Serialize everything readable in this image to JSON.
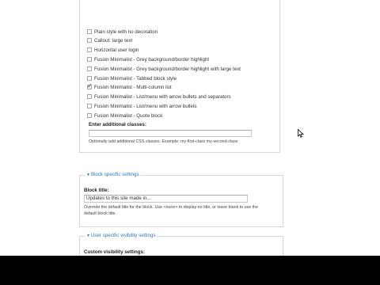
{
  "styles": {
    "options": [
      {
        "label": "Plain style with no decoration",
        "checked": false
      },
      {
        "label": "Callout: large text",
        "checked": false
      },
      {
        "label": "Horizontal user login",
        "checked": false
      },
      {
        "label": "Fusion Minimalist - Grey background/border highlight",
        "checked": false
      },
      {
        "label": "Fusion Minimalist - Grey background/border highlight with large text",
        "checked": false
      },
      {
        "label": "Fusion Minimalist - Tabbed block style",
        "checked": false
      },
      {
        "label": "Fusion Minimalist - Multi-column list",
        "checked": true
      },
      {
        "label": "Fusion Minimalist - List/menu with arrow bullets and separators",
        "checked": false
      },
      {
        "label": "Fusion Minimalist - List/menu with arrow bullets",
        "checked": false
      },
      {
        "label": "Fusion Minimalist - Quote block",
        "checked": false
      }
    ],
    "extra_label": "Enter additional classes:",
    "extra_value": "",
    "extra_help": "Optionally add additional CSS classes. Example: my-first-class my-second-class"
  },
  "block": {
    "legend": "Block specific settings",
    "title_label": "Block title:",
    "title_value": "Updates to this site made in...",
    "help_1": "Override the default title for the block. Use <none> to display no title, or leave blank to use the",
    "help_2": "default block title."
  },
  "visibility": {
    "legend": "User specific visibility settings",
    "label": "Custom visibility settings:"
  },
  "colors": {
    "legend_link": "#2a79c0",
    "border": "#cfd8e3"
  }
}
